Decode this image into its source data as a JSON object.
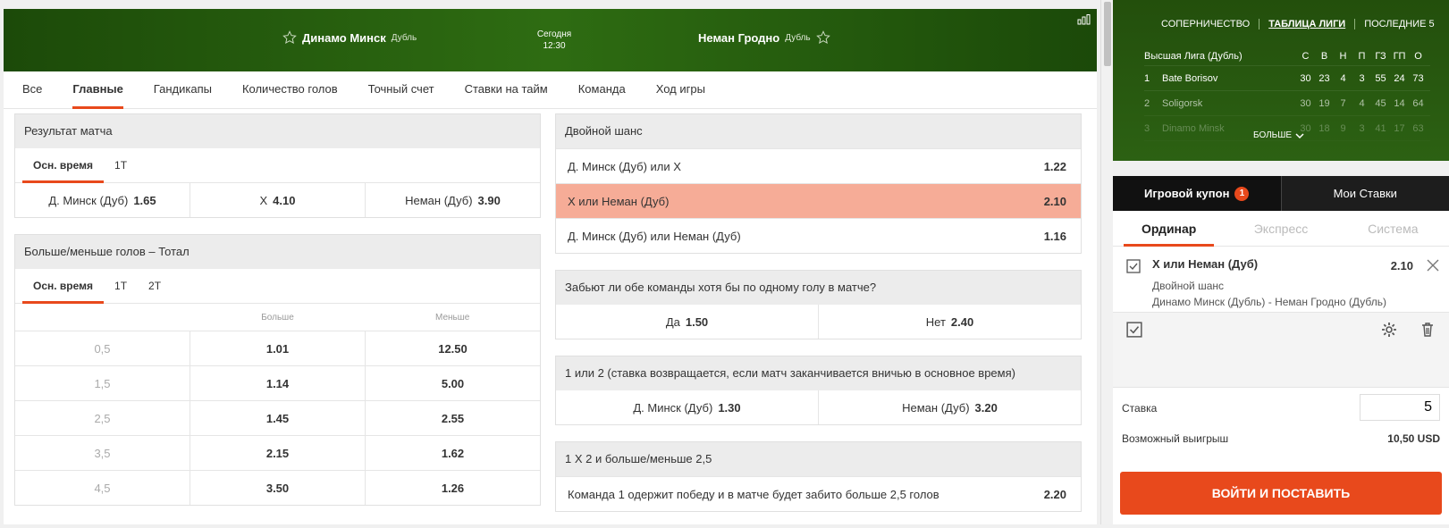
{
  "match": {
    "team1": "Динамо Минск",
    "team1_sub": "Дубль",
    "team2": "Неман Гродно",
    "team2_sub": "Дубль",
    "day": "Сегодня",
    "time": "12:30"
  },
  "tabs": [
    "Все",
    "Главные",
    "Гандикапы",
    "Количество голов",
    "Точный счет",
    "Ставки на тайм",
    "Команда",
    "Ход игры"
  ],
  "result": {
    "title": "Результат матча",
    "subtabs": [
      "Осн. время",
      "1Т"
    ],
    "outcomes": [
      {
        "label": "Д. Минск (Дуб)",
        "odd": "1.65"
      },
      {
        "label": "Х",
        "odd": "4.10"
      },
      {
        "label": "Неман (Дуб)",
        "odd": "3.90"
      }
    ]
  },
  "totals": {
    "title": "Больше/меньше голов – Тотал",
    "subtabs": [
      "Осн. время",
      "1Т",
      "2Т"
    ],
    "head_over": "Больше",
    "head_under": "Меньше",
    "rows": [
      {
        "total": "0,5",
        "over": "1.01",
        "under": "12.50"
      },
      {
        "total": "1,5",
        "over": "1.14",
        "under": "5.00"
      },
      {
        "total": "2,5",
        "over": "1.45",
        "under": "2.55"
      },
      {
        "total": "3,5",
        "over": "2.15",
        "under": "1.62"
      },
      {
        "total": "4,5",
        "over": "3.50",
        "under": "1.26"
      }
    ]
  },
  "double_chance": {
    "title": "Двойной шанс",
    "rows": [
      {
        "label": "Д. Минск (Дуб) или Х",
        "odd": "1.22"
      },
      {
        "label": "Х или Неман (Дуб)",
        "odd": "2.10"
      },
      {
        "label": "Д. Минск (Дуб) или Неман (Дуб)",
        "odd": "1.16"
      }
    ]
  },
  "btts": {
    "title": "Забьют ли обе команды хотя бы по одному голу в матче?",
    "outcomes": [
      {
        "label": "Да",
        "odd": "1.50"
      },
      {
        "label": "Нет",
        "odd": "2.40"
      }
    ]
  },
  "dnb": {
    "title": "1 или 2 (ставка возвращается, если матч заканчивается вничью в основное время)",
    "outcomes": [
      {
        "label": "Д. Минск (Дуб)",
        "odd": "1.30"
      },
      {
        "label": "Неман (Дуб)",
        "odd": "3.20"
      }
    ]
  },
  "combo": {
    "title": "1 Х 2 и больше/меньше 2,5",
    "rows": [
      {
        "label": "Команда 1 одержит победу и в матче будет забито больше 2,5 голов",
        "odd": "2.20"
      }
    ]
  },
  "league": {
    "tabs": [
      "СОПЕРНИЧЕСТВО",
      "ТАБЛИЦА ЛИГИ",
      "ПОСЛЕДНИЕ 5"
    ],
    "name": "Высшая Лига (Дубль)",
    "cols": [
      "С",
      "В",
      "Н",
      "П",
      "ГЗ",
      "ГП",
      "О"
    ],
    "rows": [
      {
        "pos": "1",
        "team": "Bate Borisov",
        "s": [
          "30",
          "23",
          "4",
          "3",
          "55",
          "24",
          "73"
        ]
      },
      {
        "pos": "2",
        "team": "Soligorsk",
        "s": [
          "30",
          "19",
          "7",
          "4",
          "45",
          "14",
          "64"
        ]
      },
      {
        "pos": "3",
        "team": "Dinamo Minsk",
        "s": [
          "30",
          "18",
          "9",
          "3",
          "41",
          "17",
          "63"
        ]
      }
    ],
    "more": "БОЛЬШЕ"
  },
  "coupon": {
    "tabs": [
      "Игровой купон",
      "Мои Ставки"
    ],
    "badge": "1",
    "types": [
      "Ординар",
      "Экспресс",
      "Система"
    ],
    "bet": {
      "selection": "Х или Неман (Дуб)",
      "odd": "2.10",
      "market": "Двойной шанс",
      "match": "Динамо Минск (Дубль) - Неман Гродно (Дубль)"
    },
    "stake_label": "Ставка",
    "stake": "5",
    "win_label": "Возможный выигрыш",
    "win_value": "10,50 USD",
    "login": "ВОЙТИ И ПОСТАВИТЬ"
  },
  "colors": {
    "accent": "#e8491c",
    "header_green": "#2e6c12",
    "selected_row": "#f6ac97"
  }
}
